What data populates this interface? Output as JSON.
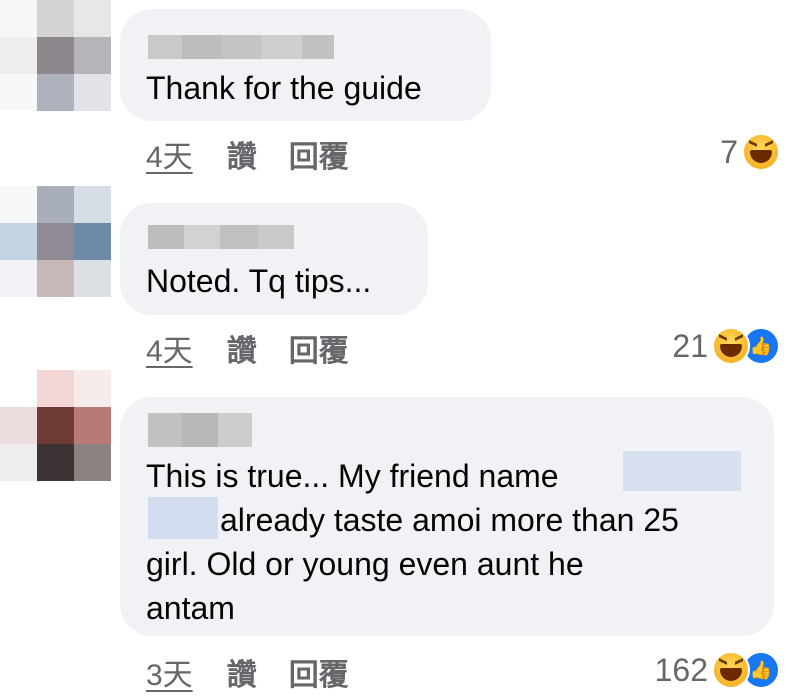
{
  "comments": [
    {
      "text_lines": [
        "Thank for the guide"
      ],
      "time": "4天",
      "like_label": "讚",
      "reply_label": "回覆",
      "reaction_count": "7",
      "reactions": [
        "haha-icon"
      ]
    },
    {
      "text_lines": [
        "Noted. Tq tips..."
      ],
      "time": "4天",
      "like_label": "讚",
      "reply_label": "回覆",
      "reaction_count": "21",
      "reactions": [
        "haha-icon",
        "like-icon"
      ]
    },
    {
      "text_lines": [
        "This is true... My friend name",
        "already taste amoi more than 25",
        "girl. Old or young even aunt he",
        "antam"
      ],
      "time": "3天",
      "like_label": "讚",
      "reply_label": "回覆",
      "reaction_count": "162",
      "reactions": [
        "haha-icon",
        "like-icon"
      ]
    }
  ],
  "colors": {
    "bubble": "#f0f2f5",
    "meta_text": "#65676b",
    "like_blue": "#1877f2",
    "haha_yellow": "#f7b125"
  }
}
